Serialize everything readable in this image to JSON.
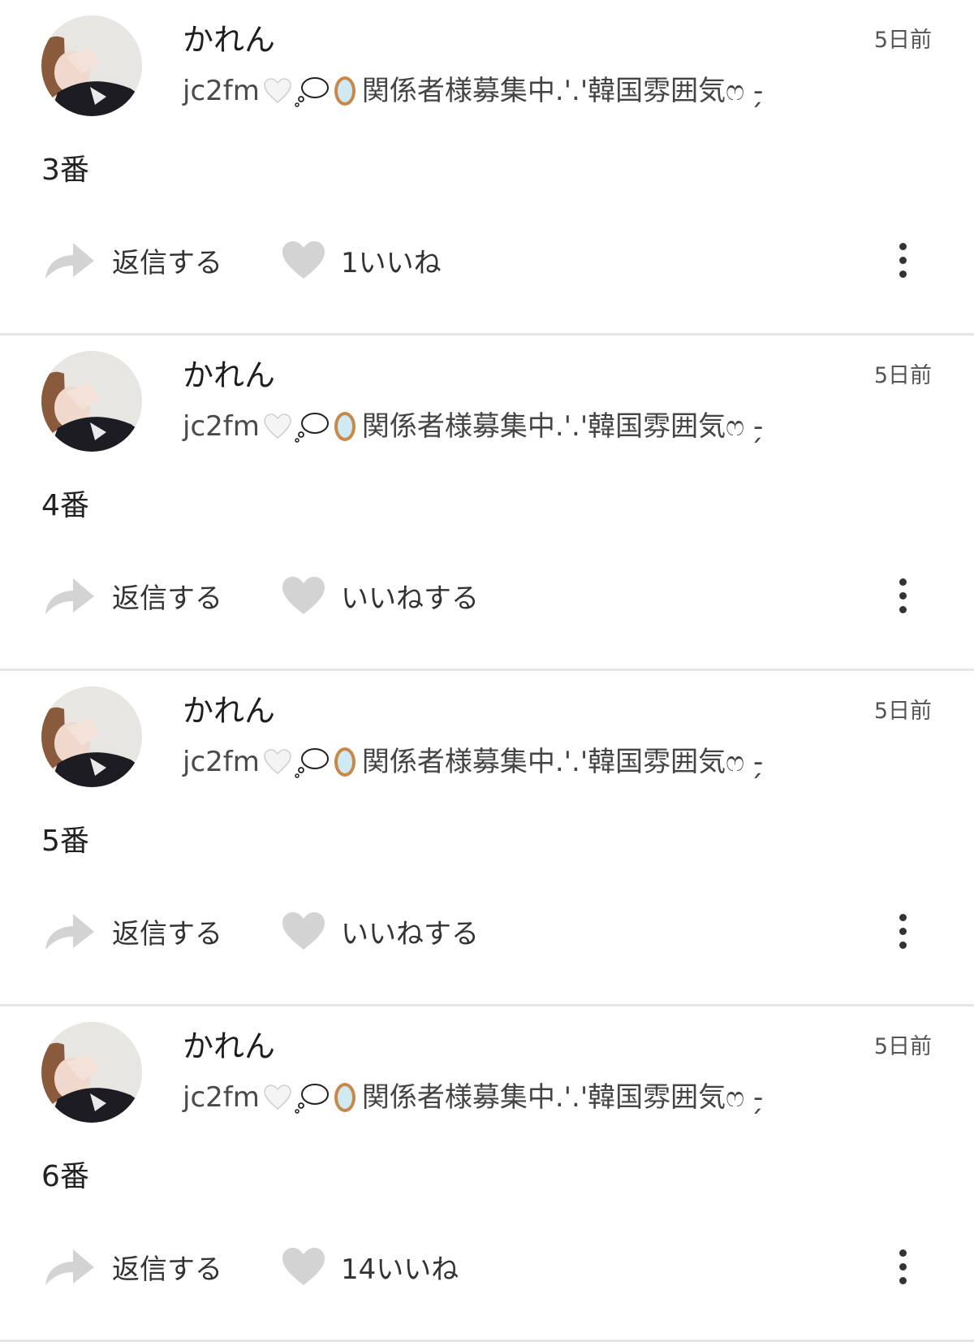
{
  "colors": {
    "text_primary": "#1e1e1e",
    "text_secondary": "#555555",
    "icon_gray": "#d3d3d3",
    "divider": "#e6e6e6",
    "mirror_frame": "#c8884a"
  },
  "icons": {
    "reply": "reply-arrow-icon",
    "like": "heart-icon",
    "more": "vertical-ellipsis-icon",
    "bio_emojis": [
      "white-heart-icon",
      "thought-bubble-icon",
      "mirror-icon"
    ]
  },
  "comments": [
    {
      "user": {
        "name": "かれん",
        "bio_id": "jc2fm",
        "bio_text": "関係者様募集中.'.'韓国雰囲気ෆ -̗"
      },
      "time": "5日前",
      "body": "3番",
      "actions": {
        "reply": "返信する",
        "like": "1いいね"
      }
    },
    {
      "user": {
        "name": "かれん",
        "bio_id": "jc2fm",
        "bio_text": "関係者様募集中.'.'韓国雰囲気ෆ -̗"
      },
      "time": "5日前",
      "body": "4番",
      "actions": {
        "reply": "返信する",
        "like": "いいねする"
      }
    },
    {
      "user": {
        "name": "かれん",
        "bio_id": "jc2fm",
        "bio_text": "関係者様募集中.'.'韓国雰囲気ෆ -̗"
      },
      "time": "5日前",
      "body": "5番",
      "actions": {
        "reply": "返信する",
        "like": "いいねする"
      }
    },
    {
      "user": {
        "name": "かれん",
        "bio_id": "jc2fm",
        "bio_text": "関係者様募集中.'.'韓国雰囲気ෆ -̗"
      },
      "time": "5日前",
      "body": "6番",
      "actions": {
        "reply": "返信する",
        "like": "14いいね"
      }
    }
  ]
}
